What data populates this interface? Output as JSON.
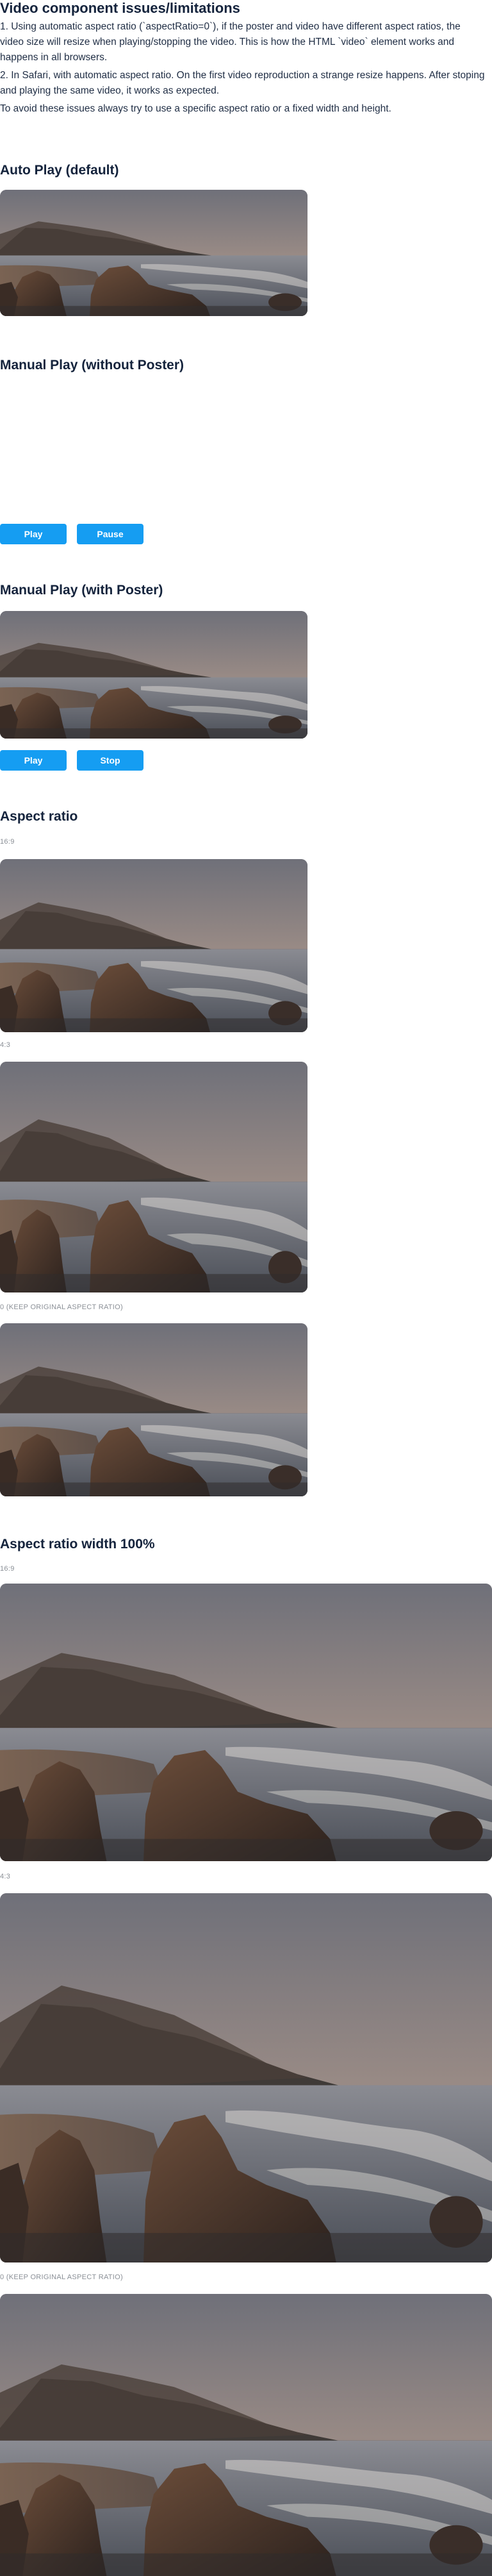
{
  "page_title": "Video component issues/limitations",
  "notes": [
    "1. Using automatic aspect ratio (`aspectRatio=0`), if the poster and video have different aspect ratios, the video size will resize when playing/stopping the video. This is how the HTML `video` element works and happens in all browsers.",
    "2. In Safari, with automatic aspect ratio. On the first video reproduction a strange resize happens. After stoping and playing the same video, it works as expected.",
    "To avoid these issues always try to use a specific aspect ratio or a fixed width and height."
  ],
  "sections": {
    "auto_play": {
      "title": "Auto Play (default)"
    },
    "manual_no_poster": {
      "title": "Manual Play (without Poster)",
      "play_label": "Play",
      "pause_label": "Pause"
    },
    "manual_poster": {
      "title": "Manual Play (with Poster)",
      "play_label": "Play",
      "stop_label": "Stop"
    },
    "aspect_ratio": {
      "title": "Aspect ratio",
      "captions": [
        "16:9",
        "4:3",
        "0 (KEEP ORIGINAL ASPECT RATIO)"
      ]
    },
    "aspect_ratio_full": {
      "title": "Aspect ratio width 100%",
      "captions": [
        "16:9",
        "4:3",
        "0 (KEEP ORIGINAL ASPECT RATIO)"
      ]
    }
  },
  "colors": {
    "primary_button": "#159df2",
    "heading_text": "#14233c",
    "caption_text": "#8a8f96"
  },
  "video_poster_description_icon": "coastal-sunset-poster"
}
